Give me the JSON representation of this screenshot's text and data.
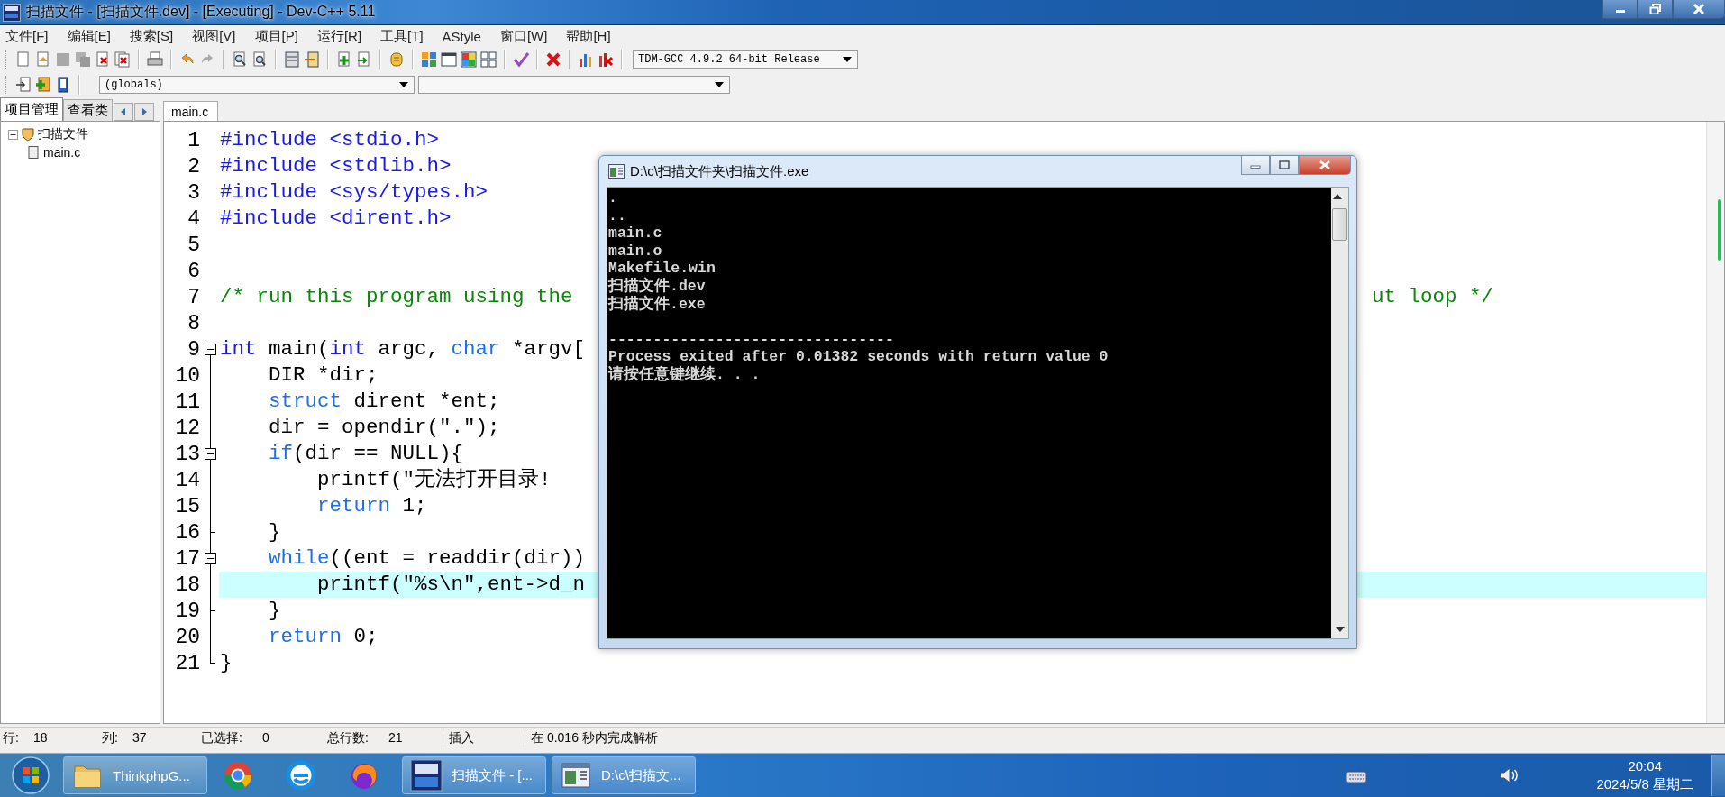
{
  "window": {
    "title": "扫描文件 - [扫描文件.dev] - [Executing] - Dev-C++ 5.11"
  },
  "menu": [
    "文件[F]",
    "编辑[E]",
    "搜索[S]",
    "视图[V]",
    "项目[P]",
    "运行[R]",
    "工具[T]",
    "AStyle",
    "窗口[W]",
    "帮助[H]"
  ],
  "compiler_select": {
    "value": "TDM-GCC 4.9.2 64-bit Release"
  },
  "scope_select": {
    "value": "(globals)"
  },
  "left_panel": {
    "tabs": [
      {
        "label": "项目管理",
        "selected": true
      },
      {
        "label": "查看类",
        "selected": false
      }
    ],
    "tree": [
      {
        "label": "扫描文件",
        "expanded": true,
        "children": [
          {
            "label": "main.c"
          }
        ]
      }
    ]
  },
  "editor": {
    "tabs": [
      {
        "label": "main.c",
        "selected": true
      }
    ],
    "lines": [
      {
        "n": "1",
        "segments": [
          [
            {
              "kind": "directive",
              "text": "#include <stdio.h>"
            }
          ]
        ]
      },
      {
        "n": "2",
        "segments": [
          [
            {
              "kind": "directive",
              "text": "#include <stdlib.h>"
            }
          ]
        ]
      },
      {
        "n": "3",
        "segments": [
          [
            {
              "kind": "directive",
              "text": "#include <sys/types.h>"
            }
          ]
        ]
      },
      {
        "n": "4",
        "segments": [
          [
            {
              "kind": "directive",
              "text": "#include <dirent.h>"
            }
          ]
        ]
      },
      {
        "n": "5"
      },
      {
        "n": "6"
      },
      {
        "n": "7",
        "segments": [
          [
            {
              "kind": "comment",
              "text": "/* run this program using the"
            }
          ],
          [
            {
              "kind": "comment",
              "text": "ut loop */"
            }
          ]
        ]
      },
      {
        "n": "8"
      },
      {
        "n": "9",
        "collapsible": true,
        "segments": [
          [
            {
              "kind": "type",
              "text": "int"
            },
            {
              "kind": "plain",
              "text": " main("
            },
            {
              "kind": "type",
              "text": "int"
            },
            {
              "kind": "plain",
              "text": " argc, "
            },
            {
              "kind": "keyword",
              "text": "char"
            },
            {
              "kind": "plain",
              "text": " *argv["
            }
          ]
        ]
      },
      {
        "n": "10",
        "segments": [
          [
            {
              "kind": "plain",
              "text": "    DIR *dir;"
            }
          ]
        ]
      },
      {
        "n": "11",
        "segments": [
          [
            {
              "kind": "keyword",
              "text": "    struct"
            },
            {
              "kind": "plain",
              "text": " dirent *ent;"
            }
          ]
        ]
      },
      {
        "n": "12",
        "segments": [
          [
            {
              "kind": "plain",
              "text": "    dir = opendir(\".\");"
            }
          ]
        ]
      },
      {
        "n": "13",
        "collapsible": true,
        "segments": [
          [
            {
              "kind": "keyword",
              "text": "    if"
            },
            {
              "kind": "plain",
              "text": "(dir == NULL){"
            }
          ]
        ]
      },
      {
        "n": "14",
        "segments": [
          [
            {
              "kind": "plain",
              "text": "        printf(\"无法打开目录!"
            }
          ]
        ]
      },
      {
        "n": "15",
        "segments": [
          [
            {
              "kind": "keyword",
              "text": "        return"
            },
            {
              "kind": "plain",
              "text": " 1;"
            }
          ]
        ]
      },
      {
        "n": "16",
        "block_end": true,
        "segments": [
          [
            {
              "kind": "plain",
              "text": "    }"
            }
          ]
        ]
      },
      {
        "n": "17",
        "collapsible": true,
        "segments": [
          [
            {
              "kind": "keyword",
              "text": "    while"
            },
            {
              "kind": "plain",
              "text": "((ent = readdir(dir))"
            }
          ]
        ]
      },
      {
        "n": "18",
        "current": true,
        "segments": [
          [
            {
              "kind": "plain",
              "text": "        printf(\"%s\\n\",ent->d_n"
            }
          ]
        ]
      },
      {
        "n": "19",
        "block_end": true,
        "segments": [
          [
            {
              "kind": "plain",
              "text": "    }"
            }
          ]
        ]
      },
      {
        "n": "20",
        "segments": [
          [
            {
              "kind": "keyword",
              "text": "    return"
            },
            {
              "kind": "plain",
              "text": " 0;"
            }
          ]
        ]
      },
      {
        "n": "21",
        "block_end": true,
        "segments": [
          [
            {
              "kind": "plain",
              "text": "}"
            }
          ]
        ]
      }
    ]
  },
  "console": {
    "title": "D:\\c\\扫描文件夹\\扫描文件.exe",
    "output": [
      ".",
      "..",
      "main.c",
      "main.o",
      "Makefile.win",
      "扫描文件.dev",
      "扫描文件.exe"
    ],
    "footer": [
      "--------------------------------",
      "Process exited after 0.01382 seconds with return value 0",
      "请按任意键继续. . ."
    ]
  },
  "status_bar": [
    {
      "label": "行:",
      "value": "18"
    },
    {
      "label": "列:",
      "value": "37"
    },
    {
      "label": "已选择:",
      "value": "0"
    },
    {
      "label": "总行数:",
      "value": "21"
    },
    {
      "text": "插入"
    },
    {
      "text": "在 0.016 秒内完成解析"
    }
  ],
  "taskbar": {
    "items": [
      {
        "kind": "folder",
        "label": "ThinkphpG..."
      },
      {
        "kind": "ring"
      },
      {
        "kind": "swirl"
      },
      {
        "kind": "flame"
      },
      {
        "kind": "ide",
        "label": "扫描文件 - [..."
      },
      {
        "kind": "terminal",
        "label": "D:\\c\\扫描文..."
      }
    ],
    "clock": {
      "time": "20:04",
      "date": "2024/5/8 星期二"
    }
  }
}
